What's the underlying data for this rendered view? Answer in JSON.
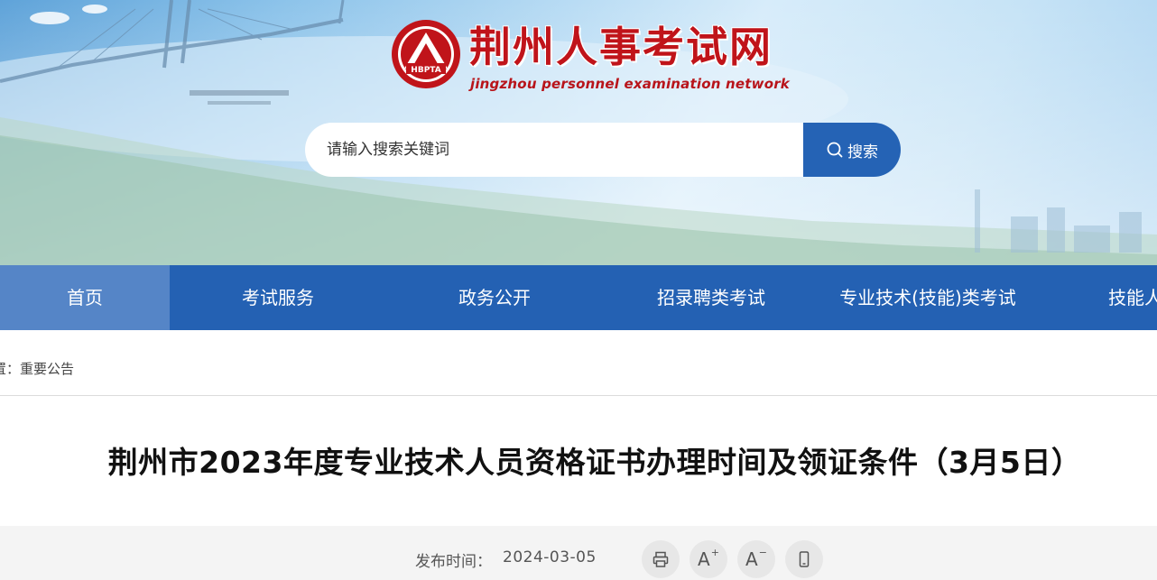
{
  "site": {
    "title": "荆州人事考试网",
    "subtitle": "jingzhou personnel examination network",
    "emblem_text": "HBPTA"
  },
  "search": {
    "placeholder": "请输入搜索关键词",
    "button_label": "搜索"
  },
  "nav": {
    "items": [
      {
        "label": "首页",
        "active": true
      },
      {
        "label": "考试服务"
      },
      {
        "label": "政务公开"
      },
      {
        "label": "招录聘类考试"
      },
      {
        "label": "专业技术(技能)类考试"
      },
      {
        "label": "技能人才"
      }
    ]
  },
  "breadcrumb": {
    "prefix": "置：",
    "current": "重要公告"
  },
  "article": {
    "title": "荆州市2023年度专业技术人员资格证书办理时间及领证条件（3月5日）",
    "publish_label": "发布时间：",
    "publish_date": "2024-03-05"
  },
  "tools": {
    "print_icon": "printer-icon",
    "font_increase": "A",
    "font_decrease": "A",
    "mobile_icon": "mobile-icon"
  },
  "colors": {
    "brand_blue": "#2461b3",
    "nav_active": "#5585c7",
    "logo_red": "#c0141a"
  }
}
